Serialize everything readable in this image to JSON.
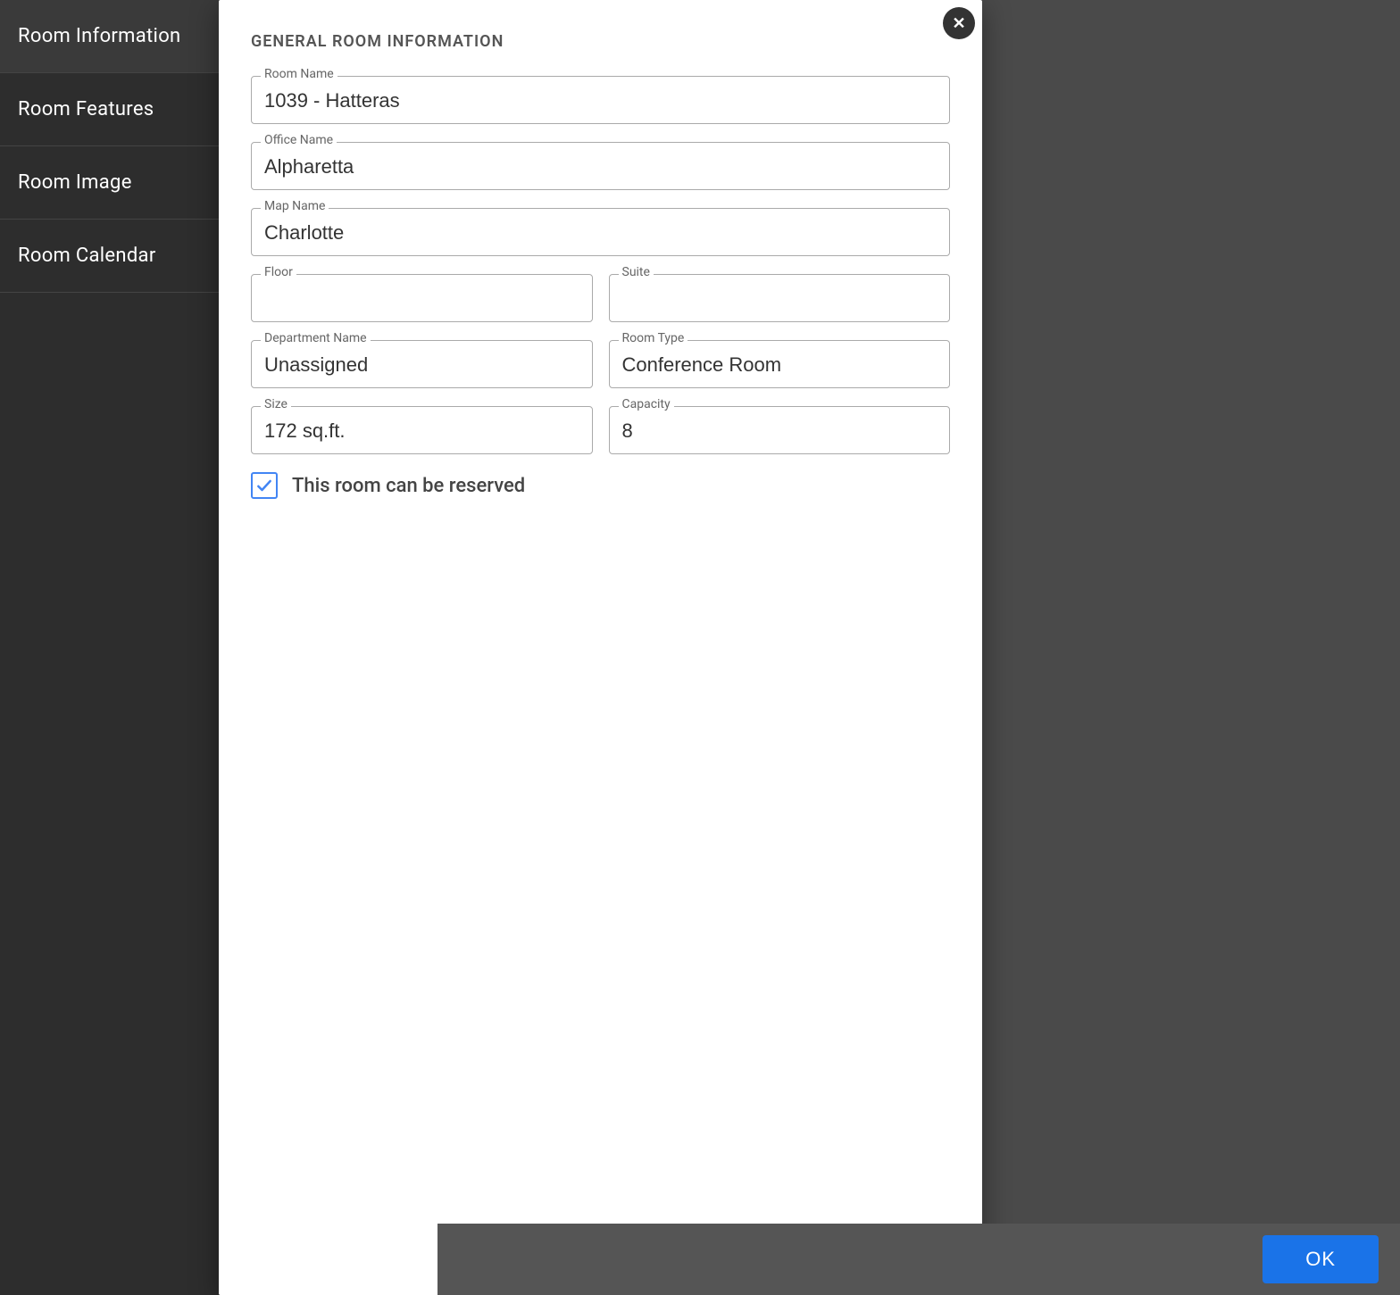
{
  "sidebar": {
    "items": [
      {
        "id": "room-information",
        "label": "Room Information",
        "active": true
      },
      {
        "id": "room-features",
        "label": "Room Features",
        "active": false
      },
      {
        "id": "room-image",
        "label": "Room Image",
        "active": false
      },
      {
        "id": "room-calendar",
        "label": "Room Calendar",
        "active": false
      }
    ]
  },
  "dialog": {
    "section_title": "GENERAL ROOM INFORMATION",
    "close_icon": "✕",
    "fields": {
      "room_name": {
        "label": "Room Name",
        "value": "1039 - Hatteras"
      },
      "office_name": {
        "label": "Office Name",
        "value": "Alpharetta"
      },
      "map_name": {
        "label": "Map Name",
        "value": "Charlotte"
      },
      "floor": {
        "label": "Floor",
        "value": ""
      },
      "suite": {
        "label": "Suite",
        "value": ""
      },
      "department_name": {
        "label": "Department Name",
        "value": "Unassigned"
      },
      "room_type": {
        "label": "Room Type",
        "value": "Conference Room"
      },
      "size": {
        "label": "Size",
        "value": "172 sq.ft."
      },
      "capacity": {
        "label": "Capacity",
        "value": "8"
      }
    },
    "checkbox": {
      "checked": true,
      "label": "This room can be reserved"
    }
  },
  "footer": {
    "ok_label": "OK"
  }
}
